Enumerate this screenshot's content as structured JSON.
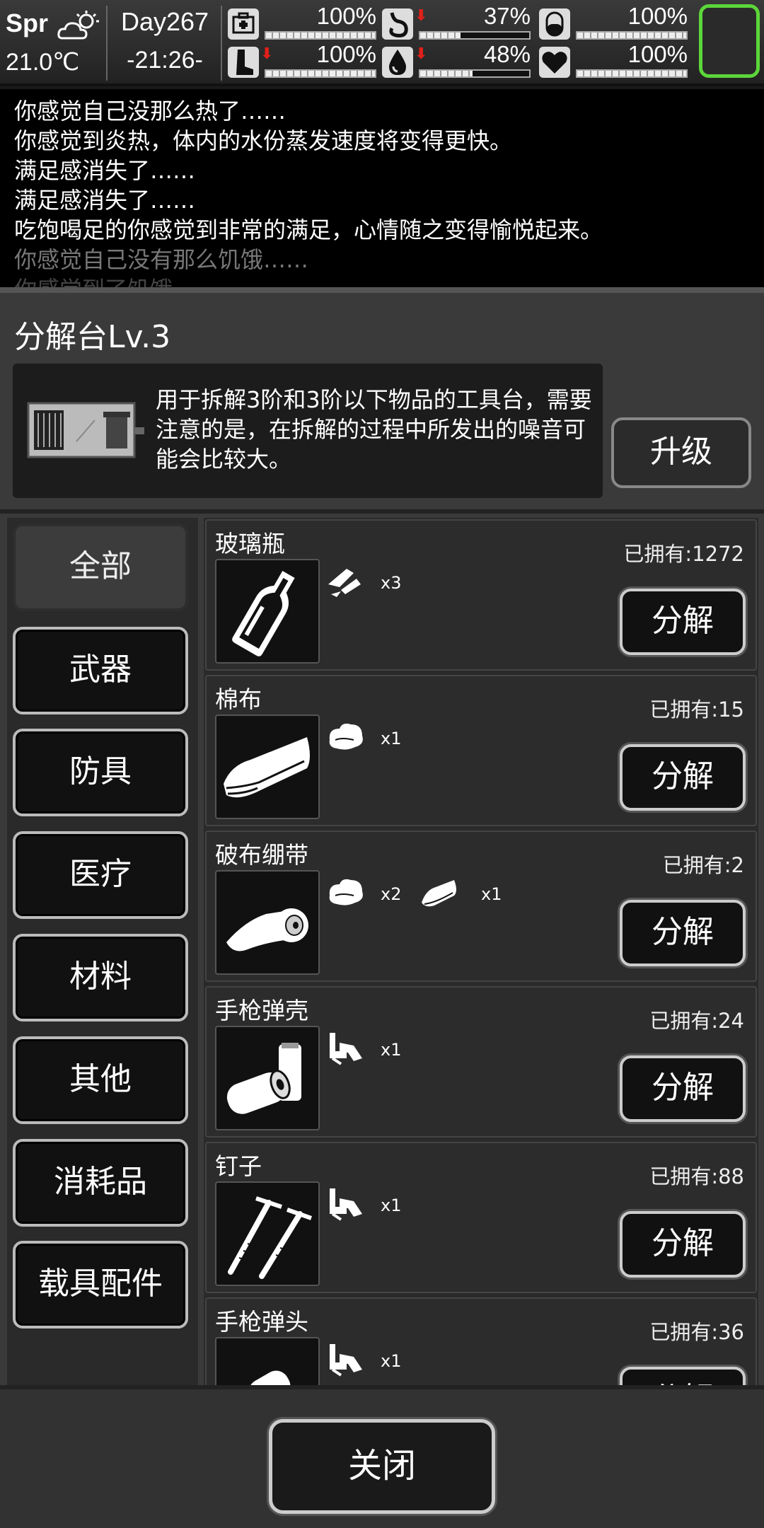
{
  "status": {
    "season": "Spr",
    "temperature": "21.0℃",
    "day": "Day267",
    "time": "-21:26-",
    "stats": [
      {
        "icon": "medkit-icon",
        "value": "100%",
        "fill": 1.0,
        "arrow": ""
      },
      {
        "icon": "stomach-icon",
        "value": "37%",
        "fill": 0.37,
        "arrow": "⬇"
      },
      {
        "icon": "pill-icon",
        "value": "100%",
        "fill": 1.0,
        "arrow": ""
      },
      {
        "icon": "leg-icon",
        "value": "100%",
        "fill": 1.0,
        "arrow": "⬇"
      },
      {
        "icon": "water-drop-icon",
        "value": "48%",
        "fill": 0.48,
        "arrow": "⬇"
      },
      {
        "icon": "heart-icon",
        "value": "100%",
        "fill": 1.0,
        "arrow": ""
      }
    ]
  },
  "log": {
    "lines": [
      "你感觉自己没那么热了……",
      "你感觉到炎热，体内的水份蒸发速度将变得更快。",
      "满足感消失了……",
      "满足感消失了……",
      "吃饱喝足的你感觉到非常的满足，心情随之变得愉悦起来。",
      "你感觉自己没有那么饥饿……",
      "你感觉到了饥饿"
    ]
  },
  "panel": {
    "title": "分解台Lv.3",
    "description": "用于拆解3阶和3阶以下物品的工具台，需要注意的是，在拆解的过程中所发出的噪音可能会比较大。",
    "upgrade_label": "升级",
    "categories": [
      "全部",
      "武器",
      "防具",
      "医疗",
      "材料",
      "其他",
      "消耗品",
      "载具配件"
    ],
    "decompose_label": "分解",
    "close_label": "关闭",
    "items": [
      {
        "name": "玻璃瓶",
        "owned": "已拥有:1272",
        "materials": [
          {
            "icon": "glass-shard-icon",
            "qty": "x3"
          }
        ]
      },
      {
        "name": "棉布",
        "owned": "已拥有:15",
        "materials": [
          {
            "icon": "cotton-icon",
            "qty": "x1"
          }
        ]
      },
      {
        "name": "破布绷带",
        "owned": "已拥有:2",
        "materials": [
          {
            "icon": "cotton-icon",
            "qty": "x2"
          },
          {
            "icon": "cloth-icon",
            "qty": "x1"
          }
        ]
      },
      {
        "name": "手枪弹壳",
        "owned": "已拥有:24",
        "materials": [
          {
            "icon": "scrap-metal-icon",
            "qty": "x1"
          }
        ]
      },
      {
        "name": "钉子",
        "owned": "已拥有:88",
        "materials": [
          {
            "icon": "scrap-metal-icon",
            "qty": "x1"
          }
        ]
      },
      {
        "name": "手枪弹头",
        "owned": "已拥有:36",
        "materials": [
          {
            "icon": "scrap-metal-icon",
            "qty": "x1"
          }
        ]
      }
    ]
  }
}
